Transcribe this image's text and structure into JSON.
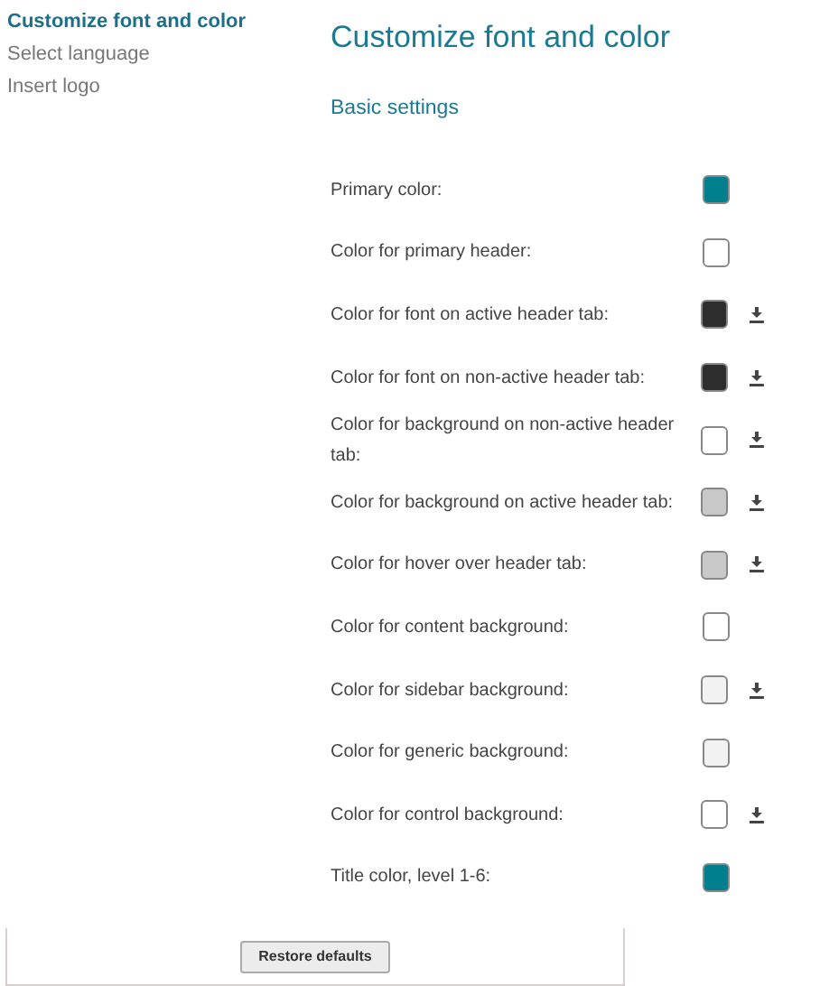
{
  "sidebar": {
    "items": [
      {
        "label": "Customize font and color",
        "selected": true
      },
      {
        "label": "Select language",
        "selected": false
      },
      {
        "label": "Insert logo",
        "selected": false
      }
    ]
  },
  "title": "Customize font and color",
  "section": "Basic settings",
  "settings": [
    {
      "label": "Primary color:",
      "color": "#00808f",
      "download": false
    },
    {
      "label": "Color for primary header:",
      "color": "#ffffff",
      "download": false
    },
    {
      "label": "Color for font on active header tab:",
      "color": "#2d2d2d",
      "download": true
    },
    {
      "label": "Color for font on non-active header tab:",
      "color": "#2d2d2d",
      "download": true
    },
    {
      "label": "Color for background on non-active header tab:",
      "color": "#ffffff",
      "download": true
    },
    {
      "label": "Color for background on active header tab:",
      "color": "#c8c8c8",
      "download": true
    },
    {
      "label": "Color for hover over header tab:",
      "color": "#c8c8c8",
      "download": true
    },
    {
      "label": "Color for content background:",
      "color": "#ffffff",
      "download": false
    },
    {
      "label": "Color for sidebar background:",
      "color": "#f2f2f2",
      "download": true
    },
    {
      "label": "Color for generic background:",
      "color": "#f2f2f2",
      "download": false
    },
    {
      "label": "Color for control background:",
      "color": "#ffffff",
      "download": true
    },
    {
      "label": "Title color, level 1-6:",
      "color": "#00808f",
      "download": false
    }
  ],
  "restore_button": "Restore defaults"
}
